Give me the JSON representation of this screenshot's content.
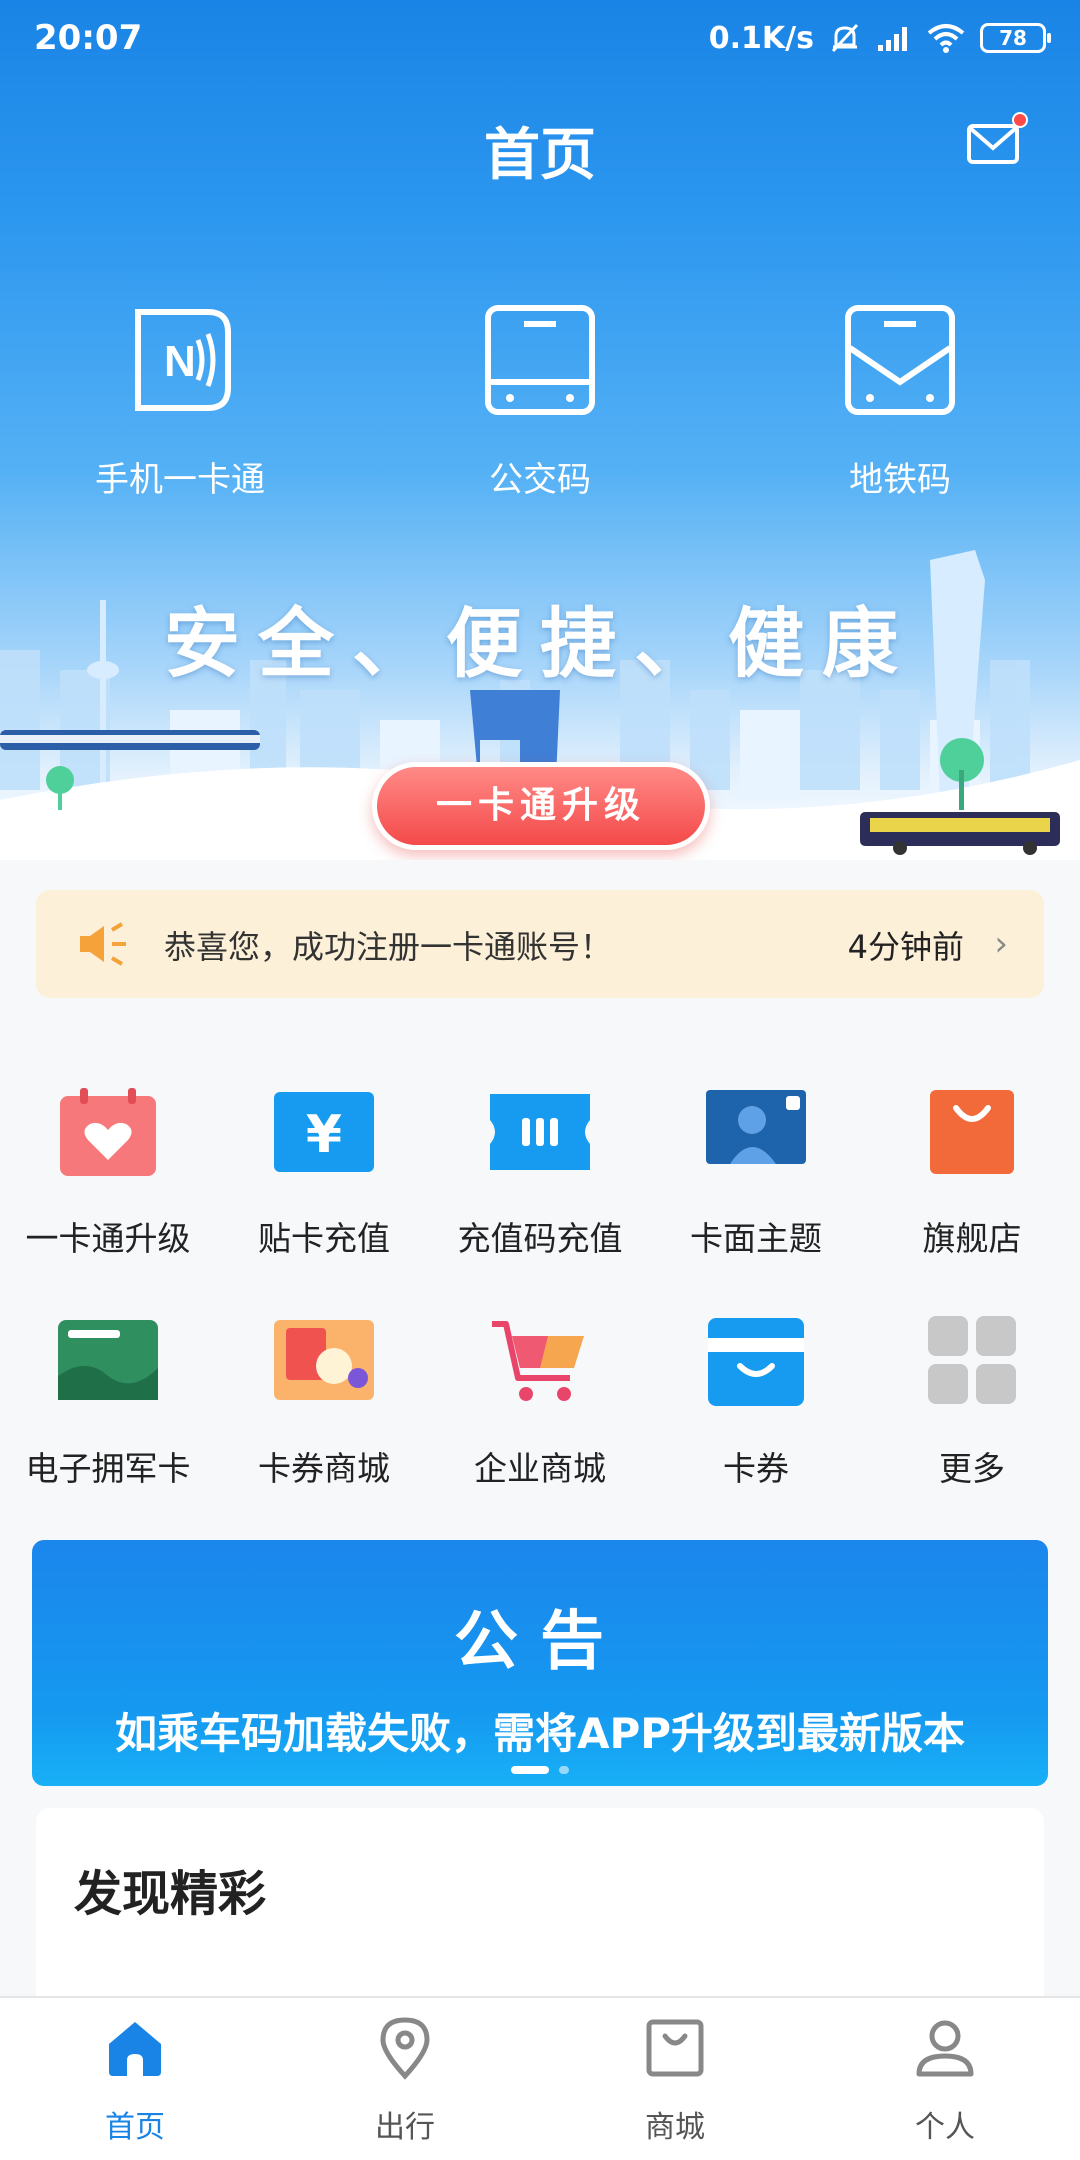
{
  "status_bar": {
    "time": "20:07",
    "net_speed": "0.1K/s",
    "battery": "78"
  },
  "header": {
    "title": "首页",
    "mail_icon": "mail-icon"
  },
  "quick_actions": [
    {
      "label": "手机一卡通",
      "icon": "nfc-card-icon"
    },
    {
      "label": "公交码",
      "icon": "bus-code-icon"
    },
    {
      "label": "地铁码",
      "icon": "subway-code-icon"
    }
  ],
  "banner": {
    "slogan": "安全、便捷、健康",
    "button_label": "一卡通升级"
  },
  "notice": {
    "text": "恭喜您，成功注册一卡通账号！",
    "time": "4分钟前",
    "icon": "speaker-icon"
  },
  "grid": [
    {
      "label": "一卡通升级",
      "icon": "calendar-heart-icon",
      "color": "#f26a6a"
    },
    {
      "label": "贴卡充值",
      "icon": "yen-icon",
      "color": "#169bf0"
    },
    {
      "label": "充值码充值",
      "icon": "ticket-icon",
      "color": "#169bf0"
    },
    {
      "label": "卡面主题",
      "icon": "card-theme-icon",
      "color": "#1e64ad"
    },
    {
      "label": "旗舰店",
      "icon": "shopping-bag-icon",
      "color": "#f26a3a"
    },
    {
      "label": "电子拥军卡",
      "icon": "military-card-icon",
      "color": "#2f8f5f"
    },
    {
      "label": "卡券商城",
      "icon": "coupon-mall-icon",
      "color": "#f7913a"
    },
    {
      "label": "企业商城",
      "icon": "cart-icon",
      "color": "#e9456a"
    },
    {
      "label": "卡券",
      "icon": "coupon-icon",
      "color": "#169bf0"
    },
    {
      "label": "更多",
      "icon": "more-grid-icon",
      "color": "#c8c8c8"
    }
  ],
  "announcement": {
    "title": "公告",
    "text": "如乘车码加载失败，需将APP升级到最新版本"
  },
  "discover": {
    "title": "发现精彩"
  },
  "tabbar": [
    {
      "label": "首页",
      "icon": "home-icon",
      "active": true
    },
    {
      "label": "出行",
      "icon": "location-icon",
      "active": false
    },
    {
      "label": "商城",
      "icon": "store-bag-icon",
      "active": false
    },
    {
      "label": "个人",
      "icon": "person-icon",
      "active": false
    }
  ],
  "colors": {
    "primary": "#1a84e6",
    "notice_bg": "#fdf0d9",
    "upgrade_red": "#f44a4a"
  }
}
